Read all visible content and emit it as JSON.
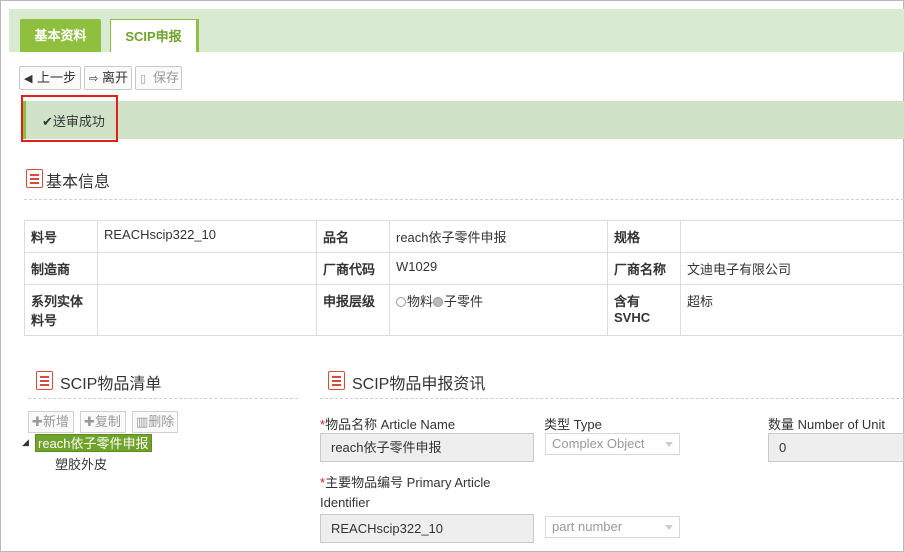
{
  "tabs": [
    {
      "label": "基本资料"
    },
    {
      "label": "SCIP申报"
    }
  ],
  "toolbar": {
    "prev": "上一步",
    "leave": "离开",
    "save": "保存"
  },
  "alert": {
    "text": "送审成功"
  },
  "basic_info": {
    "title": "基本信息",
    "rows": [
      {
        "l1": "料号",
        "v1": "REACHscip322_10",
        "l2": "品名",
        "v2": "reach依子零件申报",
        "l3": "规格",
        "v3": ""
      },
      {
        "l1": "制造商",
        "v1": "",
        "l2": "厂商代码",
        "v2": "W1029",
        "l3": "厂商名称",
        "v3": "文迪电子有限公司"
      },
      {
        "l1": "系列实体料号",
        "v1": "",
        "l2": "申报层级",
        "opt_a": "物料",
        "opt_b": "子零件",
        "l3": "含有SVHC",
        "v3": "超标"
      }
    ]
  },
  "scip_list": {
    "title": "SCIP物品清单",
    "buttons": {
      "add": "新增",
      "copy": "复制",
      "delete": "删除"
    },
    "tree": {
      "selected": "reach依子零件申报",
      "child": "塑胶外皮"
    }
  },
  "scip_info": {
    "title": "SCIP物品申报资讯",
    "article_name_label": "物品名称 Article Name",
    "article_name_value": "reach依子零件申报",
    "type_label": "类型 Type",
    "type_value": "Complex Object",
    "unit_label": "数量 Number of Unit",
    "unit_value": "0",
    "primary_label_1": "主要物品编号 Primary Article",
    "primary_label_2": "Identifier",
    "primary_value": "REACHscip322_10",
    "primary_type_value": "part number"
  },
  "colors": {
    "accent": "#8fbf3f",
    "tabbar_bg": "#d9ead3",
    "alert_bg": "#d0e3c8",
    "highlight": "#e0201b"
  }
}
